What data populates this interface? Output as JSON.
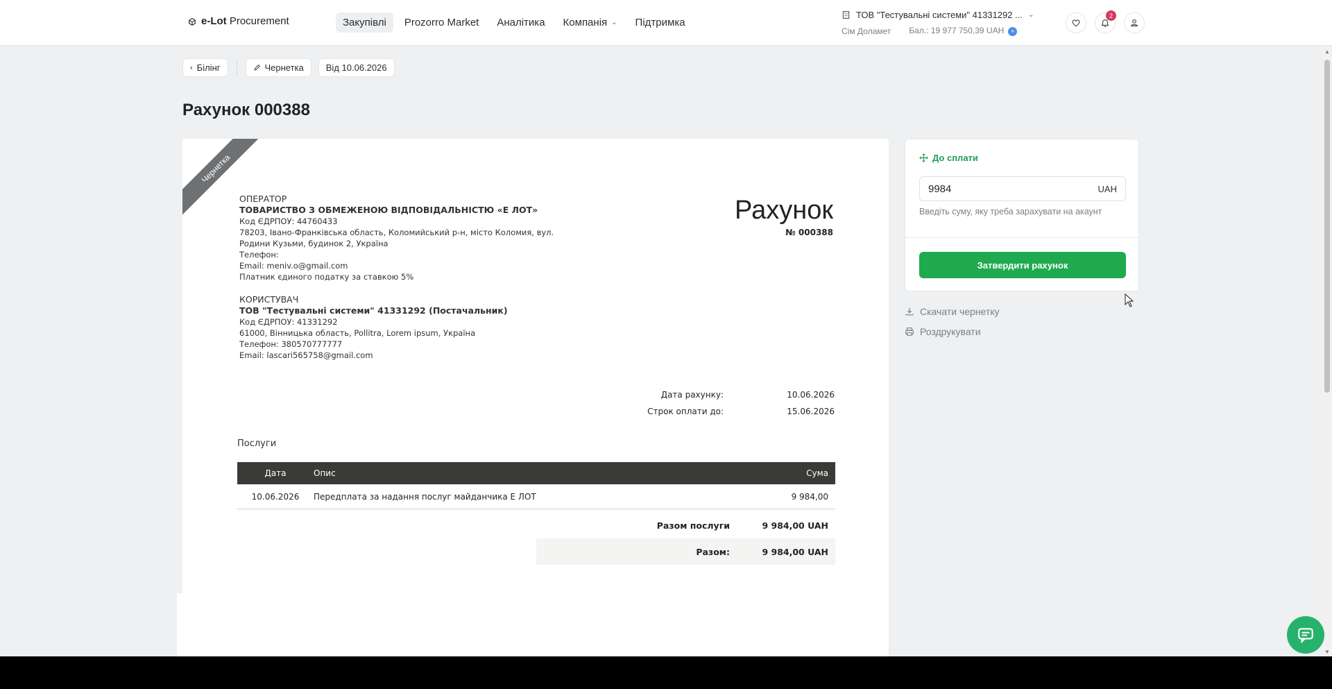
{
  "header": {
    "logo_bold": "e-Lot",
    "logo_rest": " Procurement",
    "nav": [
      {
        "label": "Закупівлі",
        "active": true
      },
      {
        "label": "Prozorro Market"
      },
      {
        "label": "Аналітика"
      },
      {
        "label": "Компанія"
      },
      {
        "label": "Підтримка"
      }
    ],
    "org_name": "ТОВ \"Тестувальні системи\" 41331292 ...",
    "user_name": "Сім Доламет",
    "balance": "Бал.: 19 977 750,39 UAH",
    "notifications_count": "2"
  },
  "breadcrumbs": {
    "back": "Білінг",
    "status": "Чернетка",
    "date": "Від 10.06.2026"
  },
  "page_title": "Рахунок 000388",
  "invoice": {
    "ribbon": "Чернетка",
    "title": "Рахунок",
    "number": "№ 000388",
    "operator": {
      "label": "ОПЕРАТОР",
      "name": "ТОВАРИСТВО З ОБМЕЖЕНОЮ ВІДПОВІДАЛЬНІСТЮ «Е ЛОТ»",
      "edrpou": "Код ЄДРПОУ: 44760433",
      "address1": "78203, Івано-Франківська область, Коломийський р-н, місто Коломия, вул.",
      "address2": "Родини Кузьми, будинок 2, Україна",
      "phone": "Телефон:",
      "email": "Email: meniv.o@gmail.com",
      "tax": "Платник єдиного податку за ставкою 5%"
    },
    "customer": {
      "label": "КОРИСТУВАЧ",
      "name": "ТОВ \"Тестувальні системи\" 41331292 (Постачальник)",
      "edrpou": "Код ЄДРПОУ: 41331292",
      "address": "61000, Вінницька область, Pollitra, Lorem ipsum, Україна",
      "phone": "Телефон: 380570777777",
      "email": "Email: lascari565758@gmail.com"
    },
    "dates": {
      "invoice_date_label": "Дата рахунку:",
      "invoice_date": "10.06.2026",
      "due_date_label": "Строк оплати до:",
      "due_date": "15.06.2026"
    },
    "services_label": "Послуги",
    "columns": {
      "date": "Дата",
      "desc": "Опис",
      "sum": "Сума"
    },
    "rows": [
      {
        "date": "10.06.2026",
        "desc": "Передплата за надання послуг майданчика Е ЛОТ",
        "sum": "9 984,00"
      }
    ],
    "subtotal_label": "Разом послуги",
    "subtotal": "9 984,00 UAH",
    "total_label": "Разом:",
    "total": "9 984,00 UAH"
  },
  "payment": {
    "heading": "До сплати",
    "amount": "9984",
    "currency": "UAH",
    "hint": "Введіть суму, яку треба зарахувати на акаунт",
    "approve_button": "Затвердити рахунок",
    "download_link": "Скачати чернетку",
    "print_link": "Роздрукувати"
  },
  "colors": {
    "accent_green": "#1faa4f",
    "chat_green": "#27b26b",
    "badge_red": "#d23b5b"
  }
}
